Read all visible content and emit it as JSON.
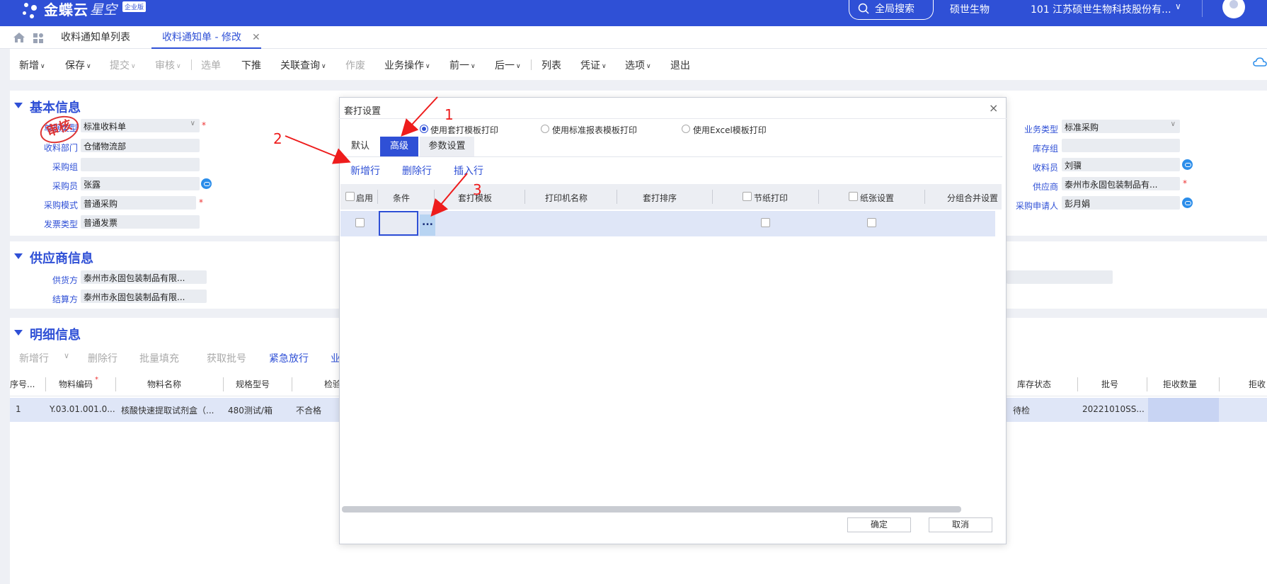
{
  "brand": {
    "name": "金蝶云",
    "product": "星空",
    "edition": "企业版"
  },
  "topbar": {
    "search": "全局搜索",
    "company": "硕世生物",
    "org": "101 江苏硕世生物科技股份有..."
  },
  "tabs": {
    "list": "收料通知单列表",
    "edit": "收料通知单 - 修改"
  },
  "toolbar": [
    "新增",
    "保存",
    "提交",
    "审核",
    "选单",
    "下推",
    "关联查询",
    "作废",
    "业务操作",
    "前一",
    "后一",
    "列表",
    "凭证",
    "选项",
    "退出"
  ],
  "basic": {
    "title": "基本信息",
    "stamp": "审核",
    "left": [
      {
        "label": "单据类型",
        "value": "标准收料单"
      },
      {
        "label": "收料部门",
        "value": "仓储物流部"
      },
      {
        "label": "采购组",
        "value": ""
      },
      {
        "label": "采购员",
        "value": "张露"
      },
      {
        "label": "采购模式",
        "value": "普通采购"
      },
      {
        "label": "发票类型",
        "value": "普通发票"
      }
    ],
    "right": [
      {
        "label": "业务类型",
        "value": "标准采购"
      },
      {
        "label": "库存组",
        "value": ""
      },
      {
        "label": "收料员",
        "value": "刘骥"
      },
      {
        "label": "供应商",
        "value": "泰州市永固包装制品有..."
      },
      {
        "label": "采购申请人",
        "value": "彭月娟"
      }
    ]
  },
  "supplier": {
    "title": "供应商信息",
    "fields": [
      {
        "label": "供货方",
        "value": "泰州市永固包装制品有限..."
      },
      {
        "label": "结算方",
        "value": "泰州市永固包装制品有限..."
      }
    ]
  },
  "detail": {
    "title": "明细信息",
    "actions": [
      "新增行",
      "删除行",
      "批量填充",
      "获取批号",
      "紧急放行",
      "业"
    ],
    "headers": [
      "序号...",
      "物料编码",
      "物料名称",
      "规格型号",
      "检验",
      "库存状态",
      "批号",
      "拒收数量",
      "拒收"
    ],
    "row": {
      "seq": "1",
      "code": "Y.03.01.001.0...",
      "name": "核酸快速提取试剂盒（...",
      "spec": "480测试/箱",
      "check": "不合格",
      "stock_status": "待检",
      "lot": "20221010SS..."
    }
  },
  "modal": {
    "title": "套打设置",
    "radios": [
      "使用套打模板打印",
      "使用标准报表模板打印",
      "使用Excel模板打印"
    ],
    "tabs": [
      "默认",
      "高级",
      "参数设置"
    ],
    "actions": [
      "新增行",
      "删除行",
      "插入行"
    ],
    "columns": [
      "启用",
      "条件",
      "套打模板",
      "打印机名称",
      "套打排序",
      "节纸打印",
      "纸张设置",
      "分组合并设置"
    ],
    "ellipsis": "...",
    "ok": "确定",
    "cancel": "取消"
  },
  "annotations": [
    "1",
    "2",
    "3"
  ]
}
